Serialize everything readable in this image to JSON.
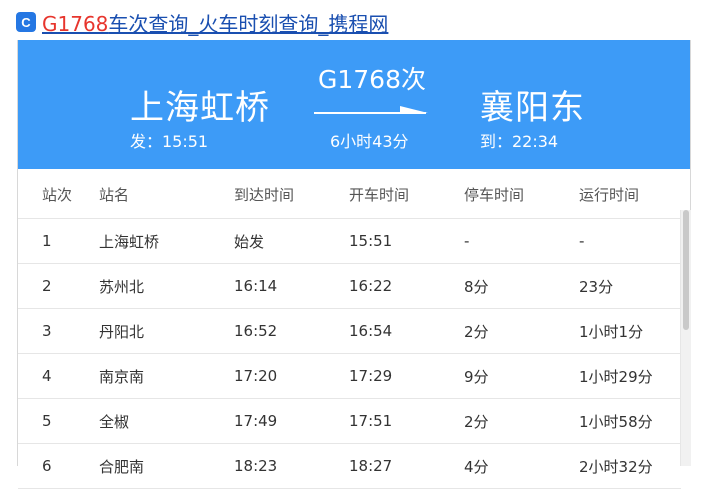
{
  "header": {
    "title_train": "G1768",
    "title_rest": "车次查询_火车时刻查询_携程网",
    "logo_icon": "ctrip-logo-icon",
    "logo_char": "C"
  },
  "banner": {
    "from_station": "上海虹桥",
    "from_time": "发：15:51",
    "train_no": "G1768次",
    "duration": "6小时43分",
    "to_station": "襄阳东",
    "to_time": "到：22:34",
    "background_color": "#3d9bf7"
  },
  "table": {
    "headers": [
      "站次",
      "站名",
      "到达时间",
      "开车时间",
      "停车时间",
      "运行时间"
    ],
    "rows": [
      [
        "1",
        "上海虹桥",
        "始发",
        "15:51",
        "-",
        "-"
      ],
      [
        "2",
        "苏州北",
        "16:14",
        "16:22",
        "8分",
        "23分"
      ],
      [
        "3",
        "丹阳北",
        "16:52",
        "16:54",
        "2分",
        "1小时1分"
      ],
      [
        "4",
        "南京南",
        "17:20",
        "17:29",
        "9分",
        "1小时29分"
      ],
      [
        "5",
        "全椒",
        "17:49",
        "17:51",
        "2分",
        "1小时58分"
      ],
      [
        "6",
        "合肥南",
        "18:23",
        "18:27",
        "4分",
        "2小时32分"
      ]
    ]
  },
  "colors": {
    "title_red": "#e7352d",
    "title_link": "#1a4fb0"
  }
}
